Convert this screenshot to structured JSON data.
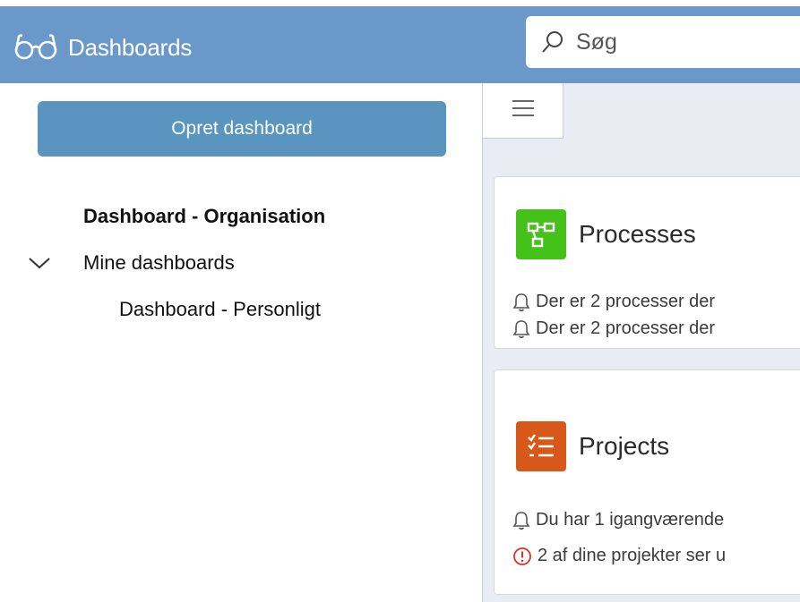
{
  "header": {
    "app_title": "Dashboards",
    "search": {
      "placeholder": "Søg",
      "value": ""
    }
  },
  "sidebar": {
    "create_button_label": "Opret dashboard",
    "items": [
      {
        "label": "Dashboard - Organisation",
        "bold": true
      },
      {
        "label": "Mine dashboards",
        "expanded": true,
        "children": [
          {
            "label": "Dashboard - Personligt"
          }
        ]
      }
    ]
  },
  "main": {
    "cards": [
      {
        "title": "Processes",
        "icon": "process-flow-icon",
        "icon_color": "#44c21a",
        "notices": [
          {
            "icon": "bell-icon",
            "text": "Der er 2 processer der"
          },
          {
            "icon": "bell-icon",
            "text": "Der er 2 processer der"
          }
        ]
      },
      {
        "title": "Projects",
        "icon": "checklist-icon",
        "icon_color": "#d8581a",
        "notices": [
          {
            "icon": "bell-icon",
            "text": "Du har 1 igangværende"
          },
          {
            "icon": "alert-circle-icon",
            "text": "2 af dine projekter ser u"
          }
        ]
      }
    ]
  },
  "colors": {
    "header_bg": "#6a99c9",
    "create_button_bg": "#5a95bf",
    "main_bg": "#e9edf3",
    "alert_red": "#d9302c"
  }
}
